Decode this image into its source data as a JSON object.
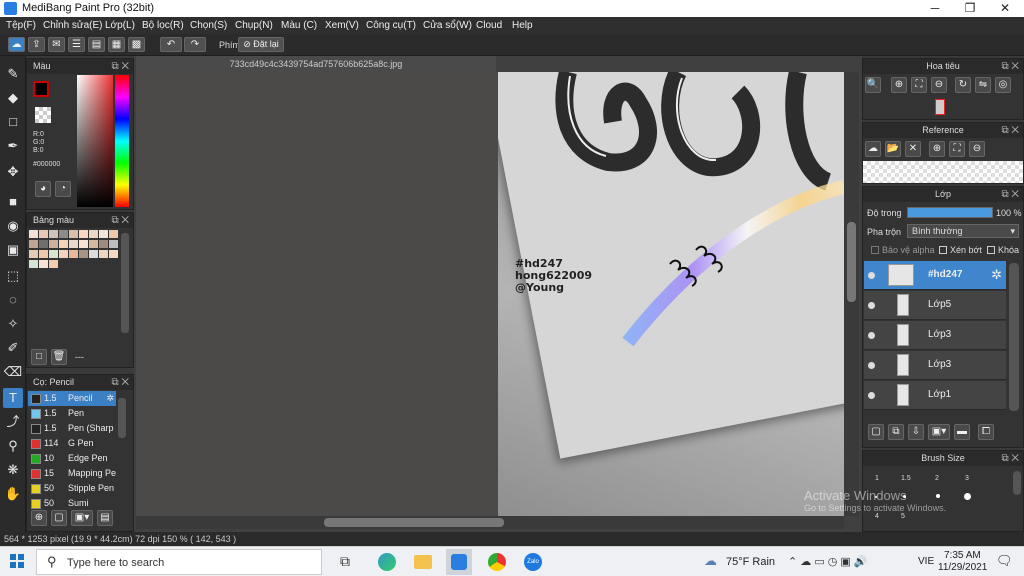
{
  "window": {
    "title": "MediBang Paint Pro (32bit)",
    "min": "─",
    "max": "❐",
    "close": "✕"
  },
  "menu": [
    "Tệp(F)",
    "Chỉnh sửa(E)",
    "Lớp(L)",
    "Bộ lọc(R)",
    "Chọn(S)",
    "Chụp(N)",
    "Màu (C)",
    "Xem(V)",
    "Công cụ(T)",
    "Cửa sổ(W)",
    "Cloud",
    "Help"
  ],
  "toolbar": {
    "key_label": "Phím",
    "reset_label": "Đặt lại"
  },
  "document": {
    "tab_title": "733cd49c4c3439754ad757606b625a8c.jpg",
    "art_text": [
      "#hd247",
      "hong622009",
      "@Young"
    ]
  },
  "color_panel": {
    "title": "Màu",
    "r": "R:0",
    "g": "G:0",
    "b": "B:0",
    "hex": "#000000"
  },
  "palette_panel": {
    "title": "Bảng màu",
    "footer": "---"
  },
  "brush_panel": {
    "title": "Cọ: Pencil",
    "items": [
      {
        "size": "1.5",
        "name": "Pencil",
        "color": "#222222"
      },
      {
        "size": "1.5",
        "name": "Pen",
        "color": "#6ec8f0"
      },
      {
        "size": "1.5",
        "name": "Pen (Sharp",
        "color": "#222222"
      },
      {
        "size": "114",
        "name": "G Pen",
        "color": "#e03030"
      },
      {
        "size": "10",
        "name": "Edge Pen",
        "color": "#22aa22"
      },
      {
        "size": "15",
        "name": "Mapping Pe",
        "color": "#e03030"
      },
      {
        "size": "50",
        "name": "Stipple Pen",
        "color": "#e8d020"
      },
      {
        "size": "50",
        "name": "Sumi",
        "color": "#e8d020"
      }
    ]
  },
  "navigator": {
    "title": "Hoa tiêu"
  },
  "reference": {
    "title": "Reference"
  },
  "layer_panel": {
    "title": "Lớp",
    "opacity_label": "Độ trong",
    "opacity_value": "100 %",
    "blend_label": "Pha trộn",
    "blend_value": "Bình thường",
    "protect_alpha": "Bảo vệ alpha",
    "clipping": "Xén bớt",
    "lock": "Khóa",
    "layers": [
      {
        "name": "#hd247",
        "selected": true
      },
      {
        "name": "Lớp5",
        "selected": false
      },
      {
        "name": "Lớp3",
        "selected": false
      },
      {
        "name": "Lớp3",
        "selected": false
      },
      {
        "name": "Lớp1",
        "selected": false
      }
    ]
  },
  "brush_size": {
    "title": "Brush Size",
    "sizes": [
      "1",
      "1.5",
      "2",
      "3"
    ],
    "second_row": [
      "4",
      "5"
    ]
  },
  "watermark": {
    "line1": "Activate Windows",
    "line2": "Go to Settings to activate Windows."
  },
  "status": {
    "text": "564 * 1253 pixel   (19.9 * 44.2cm)   72 dpi   150 %   ( 142, 543 )"
  },
  "taskbar": {
    "search_placeholder": "Type here to search",
    "weather": "75°F  Rain",
    "lang": "VIE",
    "time": "7:35 AM",
    "date": "11/29/2021"
  },
  "colors": {
    "accent": "#3b7fc4",
    "panel": "#333333",
    "selected_layer": "#3f86cc"
  }
}
